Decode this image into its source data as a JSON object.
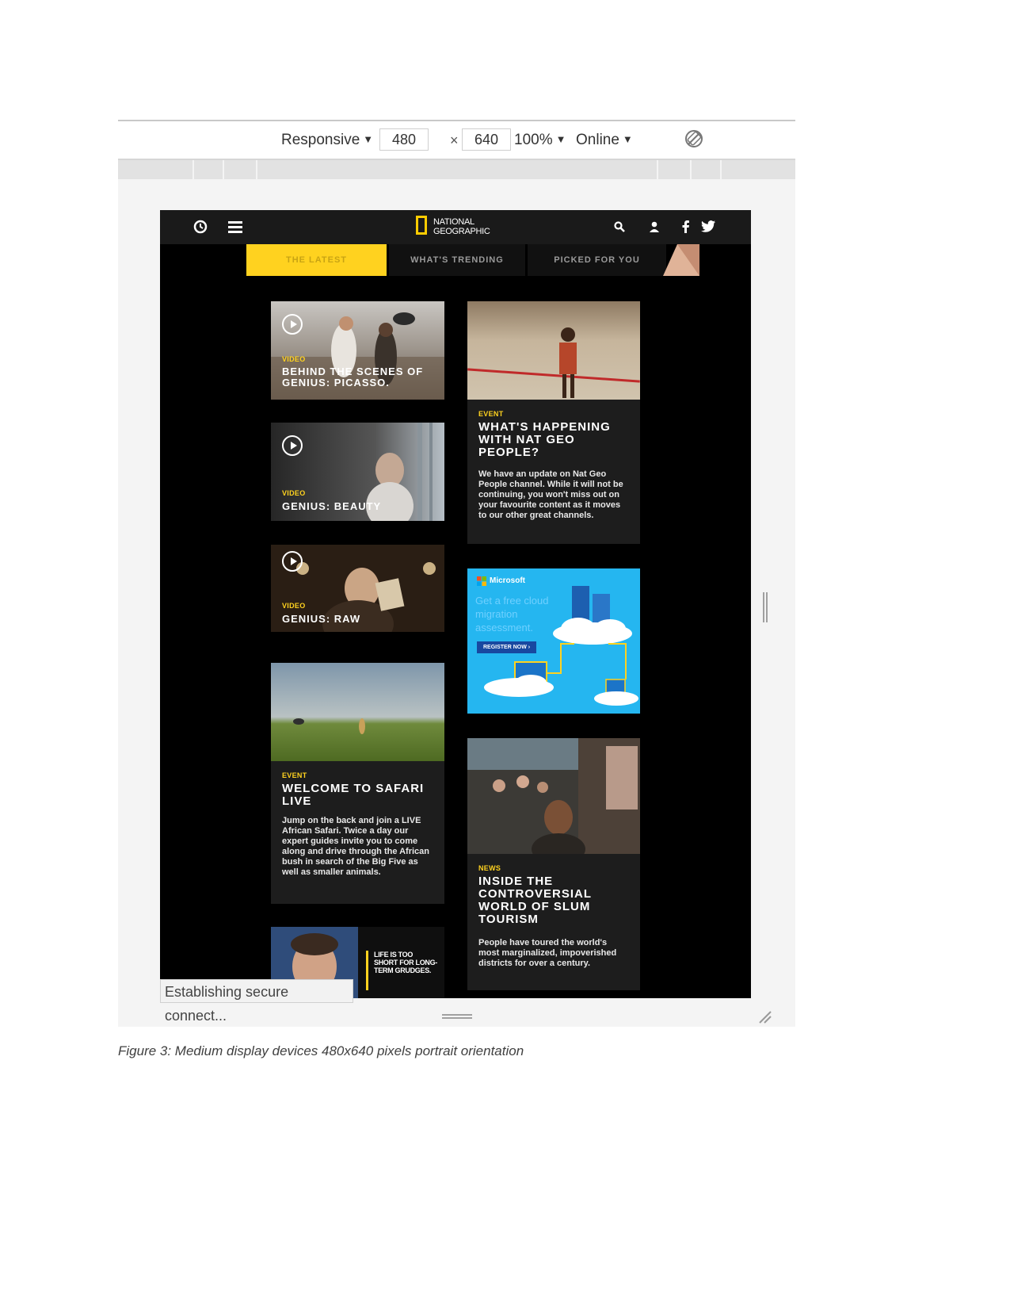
{
  "devtools": {
    "device_label": "Responsive",
    "width_value": "480",
    "times_sign": "×",
    "height_value": "640",
    "zoom_label": "100%",
    "network_label": "Online"
  },
  "site": {
    "logo_text_line1": "NATIONAL",
    "logo_text_line2": "GEOGRAPHIC",
    "header_icons": [
      "history-icon",
      "menu-icon",
      "search-icon",
      "user-icon",
      "facebook-icon",
      "twitter-icon"
    ],
    "tabs": [
      {
        "label": "THE LATEST",
        "active": true
      },
      {
        "label": "WHAT'S TRENDING",
        "active": false
      },
      {
        "label": "PICKED FOR YOU",
        "active": false
      }
    ],
    "cards": {
      "picasso": {
        "kicker": "VIDEO",
        "headline": "BEHIND THE SCENES OF GENIUS: PICASSO."
      },
      "beauty": {
        "kicker": "VIDEO",
        "headline": "GENIUS: BEAUTY"
      },
      "raw": {
        "kicker": "VIDEO",
        "headline": "GENIUS: RAW"
      },
      "safari": {
        "kicker": "EVENT",
        "headline": "WELCOME TO SAFARI LIVE",
        "body": "Jump on the back and join a LIVE African Safari. Twice a day our expert guides invite you to come along and drive through the African bush in search of the Big Five as well as smaller animals."
      },
      "natgeo_people": {
        "kicker": "EVENT",
        "headline": "WHAT'S HAPPENING WITH NAT GEO PEOPLE?",
        "body": "We have an update on Nat Geo People channel. While it will not be continuing, you won't miss out on your favourite content as it moves to our other great channels."
      },
      "slum": {
        "kicker": "NEWS",
        "headline": "INSIDE THE CONTROVERSIAL WORLD OF SLUM TOURISM",
        "body": "People have toured the world's most marginalized, impoverished districts for over a century."
      },
      "grudges": {
        "overlay_text": "LIFE IS TOO SHORT FOR LONG-TERM GRUDGES."
      }
    },
    "ad": {
      "brand": "Microsoft",
      "copy": "Get a free cloud migration assessment.",
      "button": "REGISTER NOW ›",
      "colors": {
        "background": "#25b6f0",
        "button": "#1848a0"
      }
    },
    "accent_color": "#ffd21f"
  },
  "browser_status": "Establishing secure connect...",
  "caption": "Figure 3: Medium display devices 480x640 pixels portrait orientation"
}
